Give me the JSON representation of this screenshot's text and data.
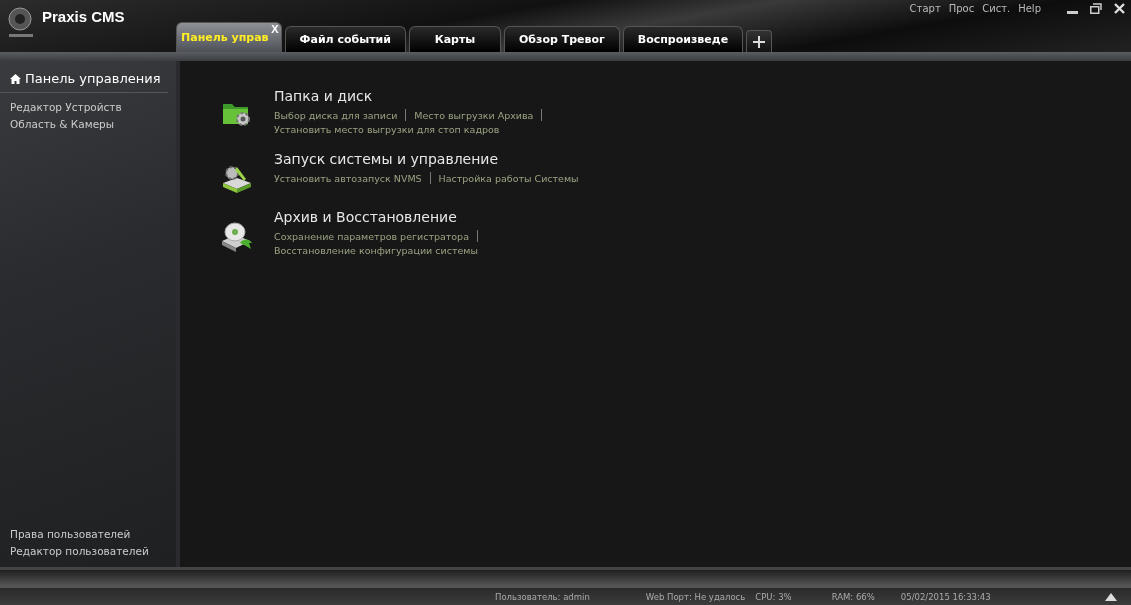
{
  "app": {
    "title": "Praxis CMS"
  },
  "menu": [
    "Старт",
    "Прос",
    "Сист.",
    "Help"
  ],
  "tabs": [
    {
      "label": "Панель управ",
      "selected": true,
      "close": "X"
    },
    {
      "label": "Файл событий",
      "selected": false
    },
    {
      "label": "Карты",
      "selected": false
    },
    {
      "label": "Обзор Тревог",
      "selected": false
    },
    {
      "label": "Воспроизведе",
      "selected": false
    }
  ],
  "sidebar": {
    "heading": "Панель управления",
    "items": [
      {
        "label": "Редактор Устройств"
      },
      {
        "label": "Область & Камеры"
      }
    ],
    "bottom_items": [
      {
        "label": "Права пользователей"
      },
      {
        "label": "Редактор пользователей"
      }
    ]
  },
  "sections": [
    {
      "kind": "folder",
      "title": "Папка и диск",
      "lines": [
        [
          {
            "label": "Выбор диска для записи",
            "separator_after": true
          },
          {
            "label": "Место выгрузки Архива",
            "separator_after": true
          }
        ],
        [
          {
            "label": "Установить место выгрузки для стоп кадров",
            "separator_after": false
          }
        ]
      ]
    },
    {
      "kind": "tools",
      "title": "Запуск системы и управление",
      "lines": [
        [
          {
            "label": "Установить автозапуск NVMS",
            "separator_after": true
          },
          {
            "label": "Настройка работы Системы",
            "separator_after": false
          }
        ]
      ]
    },
    {
      "kind": "backup",
      "title": "Архив и Восстановление",
      "lines": [
        [
          {
            "label": "Сохранение параметров регистратора",
            "separator_after": true
          }
        ],
        [
          {
            "label": "Восстановление конфигурации системы",
            "separator_after": false
          }
        ]
      ]
    }
  ],
  "status_bar": {
    "user": "Пользователь: admin",
    "web_port": "Web Порт: Не удалось",
    "cpu": "CPU: 3%",
    "ram": "RAM: 66%",
    "datetime": "05/02/2015 16:33:43"
  }
}
